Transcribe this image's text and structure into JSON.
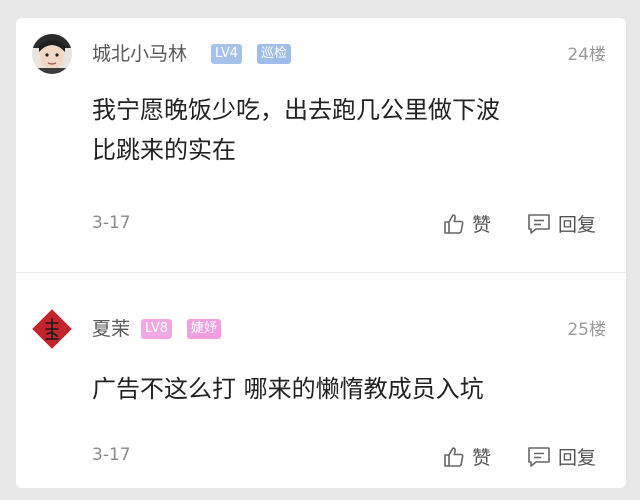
{
  "comments": [
    {
      "username": "城北小马林",
      "level": "LV4",
      "role": "巡检",
      "level_color": "#a7c2ea",
      "role_color": "#9fbcea",
      "floor": "24楼",
      "content_line1": "我宁愿晚饭少吃，出去跑几公里做下波",
      "content_line2": "比跳来的实在",
      "date": "3-17",
      "like_label": "赞",
      "reply_label": "回复",
      "avatar": "user-photo"
    },
    {
      "username": "夏茉",
      "level": "LV8",
      "role": "婕妤",
      "level_color": "#f0a7e4",
      "role_color": "#ef9fe0",
      "floor": "25楼",
      "content_line1": "广告不这么打 哪来的懒惰教成员入坑",
      "date": "3-17",
      "like_label": "赞",
      "reply_label": "回复",
      "avatar": "red-diamond-seal",
      "avatar_color": "#c3252c"
    }
  ],
  "icons": {
    "like": "thumbs-up-icon",
    "reply": "comment-bubble-icon"
  }
}
